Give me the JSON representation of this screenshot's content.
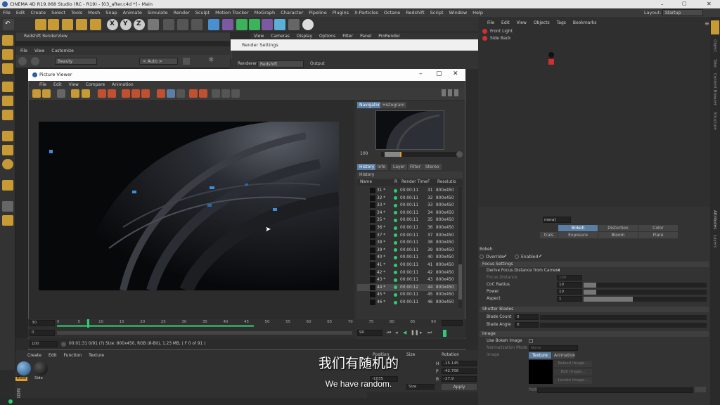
{
  "app": {
    "title": "CINEMA 4D R19.068 Studio (RC - R19) - [03_after.c4d *] - Main",
    "layout_label": "Layout:",
    "layout_value": "Startup"
  },
  "main_menu": [
    "File",
    "Edit",
    "Create",
    "Select",
    "Tools",
    "Mesh",
    "Snap",
    "Animate",
    "Simulate",
    "Render",
    "Sculpt",
    "Motion Tracker",
    "MoGraph",
    "Character",
    "Pipeline",
    "Plugins",
    "X-Particles",
    "Octane",
    "Redshift",
    "Script",
    "Window",
    "Help"
  ],
  "render_view": {
    "title": "Redshift RenderView",
    "menu": [
      "File",
      "View",
      "Customize"
    ],
    "beauty": "Beauty",
    "auto": "< Auto >"
  },
  "viewport_menu": [
    "View",
    "Cameras",
    "Display",
    "Options",
    "Filter",
    "Panel",
    "ProRender"
  ],
  "render_settings": {
    "title": "Render Settings",
    "renderer_label": "Renderer",
    "renderer_value": "Redshift",
    "output_label": "Output"
  },
  "picture_viewer": {
    "title": "Picture Viewer",
    "menu": [
      "File",
      "Edit",
      "View",
      "Compare",
      "Animation"
    ],
    "side_tabs": [
      "Navigator",
      "Histogram"
    ],
    "zoom": "100",
    "info_tabs": [
      "History",
      "Info",
      "Layer",
      "Filter",
      "Stereo"
    ],
    "history_label": "History",
    "history_columns": [
      "Name",
      "R",
      "Render Time",
      "F",
      "Resolutio"
    ],
    "history_rows": [
      {
        "name": "31 *",
        "time": "00:00:11",
        "frame": "31",
        "res": "800x450"
      },
      {
        "name": "32 *",
        "time": "00:00:11",
        "frame": "32",
        "res": "800x450"
      },
      {
        "name": "33 *",
        "time": "00:00:11",
        "frame": "33",
        "res": "800x450"
      },
      {
        "name": "34 *",
        "time": "00:00:11",
        "frame": "34",
        "res": "800x450"
      },
      {
        "name": "35 *",
        "time": "00:00:11",
        "frame": "35",
        "res": "800x450"
      },
      {
        "name": "36 *",
        "time": "00:00:11",
        "frame": "36",
        "res": "800x450"
      },
      {
        "name": "37 *",
        "time": "00:00:11",
        "frame": "37",
        "res": "800x450"
      },
      {
        "name": "38 *",
        "time": "00:00:11",
        "frame": "38",
        "res": "800x450"
      },
      {
        "name": "39 *",
        "time": "00:00:11",
        "frame": "39",
        "res": "800x450"
      },
      {
        "name": "40 *",
        "time": "00:00:11",
        "frame": "40",
        "res": "800x450"
      },
      {
        "name": "41 *",
        "time": "00:00:11",
        "frame": "41",
        "res": "800x450"
      },
      {
        "name": "42 *",
        "time": "00:00:11",
        "frame": "42",
        "res": "800x450"
      },
      {
        "name": "43 *",
        "time": "00:00:11",
        "frame": "43",
        "res": "800x450"
      },
      {
        "name": "44 *",
        "time": "00:00:12",
        "frame": "44",
        "res": "800x450"
      },
      {
        "name": "45 *",
        "time": "00:00:11",
        "frame": "45",
        "res": "800x450"
      },
      {
        "name": "46 *",
        "time": "00:00:11",
        "frame": "46",
        "res": "800x450"
      }
    ],
    "timeline_ticks": [
      "0",
      "5",
      "7",
      "10",
      "15",
      "20",
      "25",
      "30",
      "35",
      "40",
      "45",
      "50",
      "55",
      "60",
      "65",
      "70",
      "75",
      "80",
      "85",
      "90"
    ],
    "frame_start": "30",
    "frame_current": "0",
    "frame_end": "90",
    "zoom_field": "100",
    "status": "00:01:31 0/91 (?)    Size: 800x450, RGB (8-Bit), 1.23 MB,  ( F 0 of 91 )"
  },
  "object_manager": {
    "menu": [
      "File",
      "Edit",
      "View",
      "Objects",
      "Tags",
      "Bookmarks"
    ],
    "objects": [
      "Front Light",
      "Side Back"
    ]
  },
  "attribute_manager": {
    "tabs_row1": [
      "Bokeh",
      "Distortion",
      "Color Management"
    ],
    "tabs_row2": [
      "trals",
      "Exposure",
      "Bloom",
      "Flare"
    ],
    "mode_field": "mera]",
    "section_title": "Bokeh",
    "override_label": "Override",
    "enabled_label": "Enabled",
    "focus_settings": "Focus Settings",
    "derive_focus": "Derive Focus Distance from Camera",
    "focus_distance_label": "Focus Distance",
    "focus_distance_value": "100",
    "coc_label": "CoC Radius",
    "coc_value": "10",
    "power_label": "Power",
    "power_value": "10",
    "aspect_label": "Aspect",
    "aspect_value": "1",
    "shutter_blades": "Shutter Blades",
    "blade_count_label": "Blade Count",
    "blade_count_value": "0",
    "blade_angle_label": "Blade Angle",
    "blade_angle_value": "0",
    "image_section": "Image",
    "use_bokeh_image": "Use Bokeh Image",
    "normalization_label": "Normalization Mode",
    "normalization_value": "None",
    "image_label": "Image",
    "image_tab1": "Texture",
    "image_tab2": "Animation",
    "reload_button": "Reload Image...",
    "edit_button": "Edit Image...",
    "locate_button": "Locate Image...",
    "path_label": "Path"
  },
  "right_strip": [
    "Object",
    "Take",
    "Content Browser",
    "Structure",
    "Attributes",
    "Layers"
  ],
  "material_manager": {
    "menu": [
      "Create",
      "Edit",
      "Function",
      "Texture"
    ],
    "materials": [
      "Base",
      "Side"
    ]
  },
  "coordinates": {
    "headers": [
      "Position",
      "Size",
      "Rotation"
    ],
    "rotation": [
      "-15.145",
      "-42.706",
      "-27.9"
    ],
    "rotation_axes": [
      "H",
      "P",
      "B"
    ],
    "x_value": "-1035",
    "size_label": "Size",
    "apply_button": "Apply"
  },
  "subtitle": {
    "zh": "我们有随机的",
    "en": "We have random."
  },
  "colors": {
    "accent": "#5b7fa3",
    "dot_green": "#2ecc71",
    "highlight_orange": "#e0a030",
    "red_icon": "#d03030"
  }
}
